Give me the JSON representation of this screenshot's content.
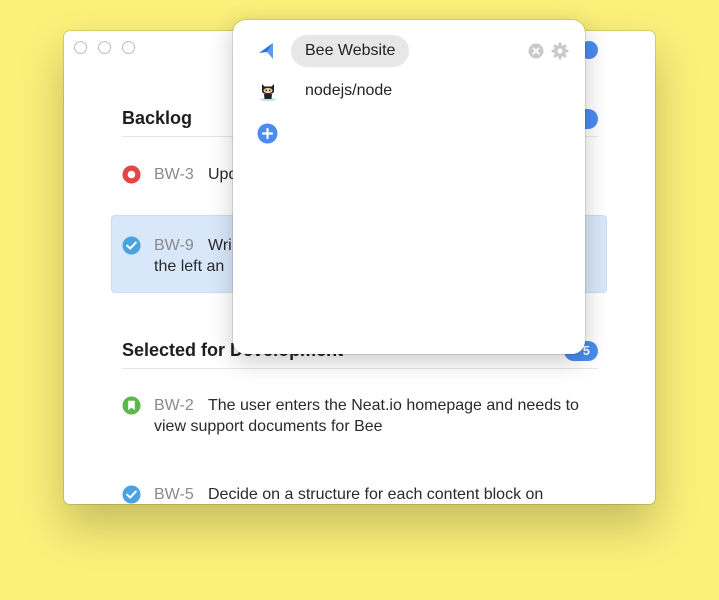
{
  "window": {
    "sections": [
      {
        "title": "Backlog",
        "issues": [
          {
            "key": "BW-3",
            "text": "Upd",
            "status": "blocked"
          },
          {
            "key": "BW-9",
            "text": "Wri",
            "text2": "the left an",
            "status": "done",
            "selected": true
          }
        ]
      },
      {
        "title": "Selected for Development",
        "count": "5",
        "issues": [
          {
            "key": "BW-2",
            "text": "The user enters the Neat.io homepage and needs to view support documents for Bee",
            "status": "story"
          },
          {
            "key": "BW-5",
            "text": "Decide on a structure for each content block on",
            "status": "done"
          }
        ]
      }
    ]
  },
  "popover": {
    "accounts": [
      {
        "label": "Bee Website",
        "icon": "jira-logo-icon",
        "active": true
      },
      {
        "label": "nodejs/node",
        "icon": "github-octocat-icon",
        "active": false
      }
    ],
    "add_icon": "add-account-icon"
  },
  "colors": {
    "background": "#fbf07a",
    "accent": "#4a8cf0",
    "blocked": "#e04848",
    "done": "#4aa3e0",
    "story": "#5cb84c",
    "selection": "#d8e8fa"
  }
}
